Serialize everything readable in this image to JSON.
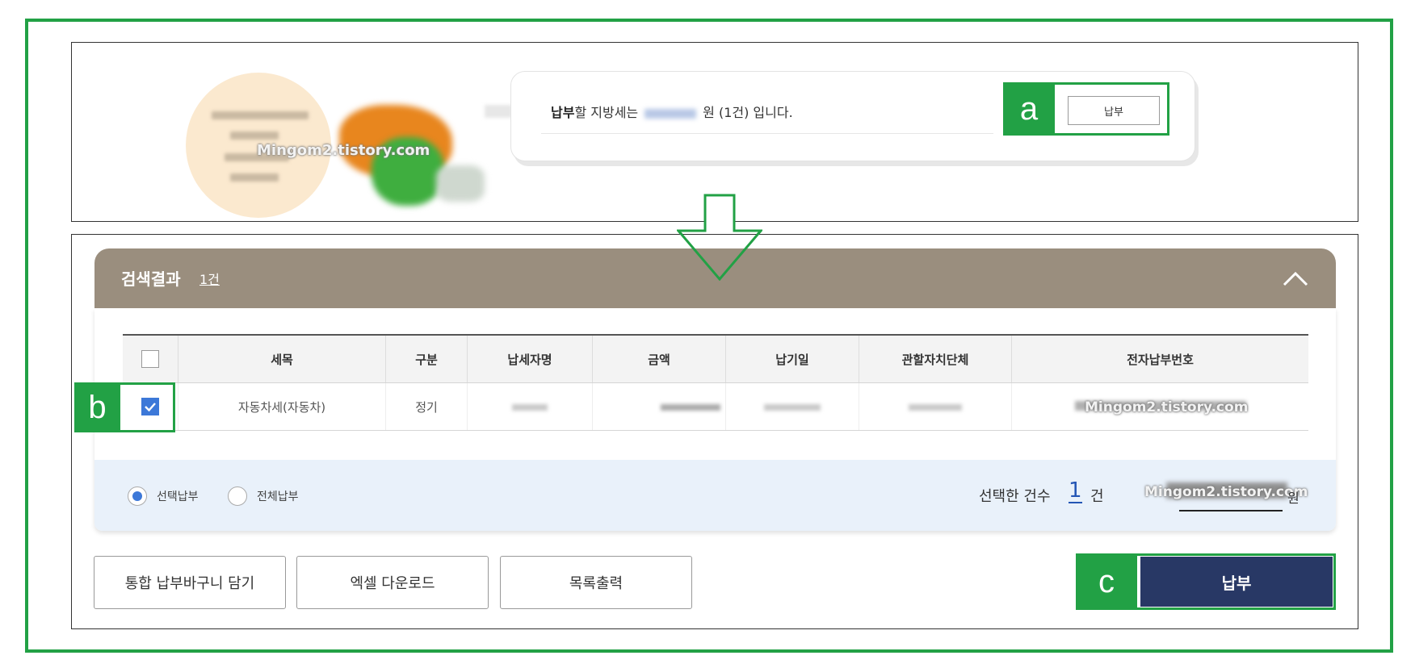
{
  "watermark": "Mingom2.tistory.com",
  "notice": {
    "bold": "납부",
    "prefix": "할 지방세는",
    "suffix": "원 (1건) 입니다.",
    "pay_label": "납부"
  },
  "annotations": {
    "a": "a",
    "b": "b",
    "c": "c"
  },
  "results": {
    "title": "검색결과",
    "count": "1건",
    "columns": [
      "세목",
      "구분",
      "납세자명",
      "금액",
      "납기일",
      "관할자치단체",
      "전자납부번호"
    ],
    "rows": [
      {
        "tax_item": "자동차세(자동차)",
        "type": "정기",
        "checked": true
      }
    ]
  },
  "payment_options": {
    "selected": "선택납부",
    "all": "전체납부",
    "selected_count_label": "선택한 건수",
    "selected_count": "1",
    "selected_count_unit": "건",
    "total_unit": "원"
  },
  "buttons": {
    "cart": "통합 납부바구니 담기",
    "excel": "엑셀 다운로드",
    "print": "목록출력",
    "pay": "납부"
  },
  "colors": {
    "annotation_green": "#22a145",
    "header_brown": "#9a8e7e",
    "pay_navy": "#283865",
    "check_blue": "#3c78d8"
  }
}
